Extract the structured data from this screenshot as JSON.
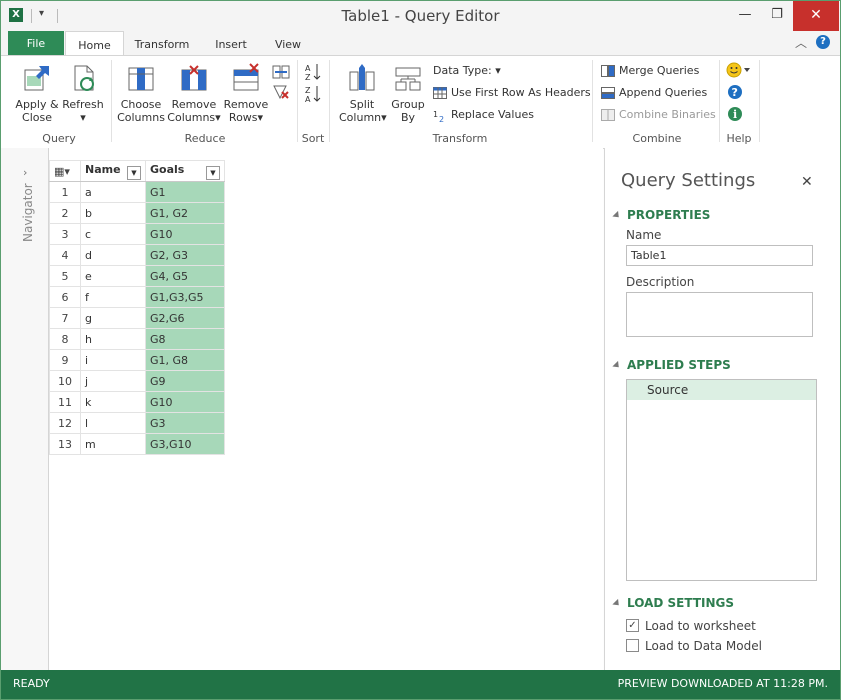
{
  "window": {
    "title": "Table1 - Query Editor",
    "app_icon": "X"
  },
  "tabs": [
    {
      "label": "File"
    },
    {
      "label": "Home"
    },
    {
      "label": "Transform"
    },
    {
      "label": "Insert"
    },
    {
      "label": "View"
    }
  ],
  "ribbon": {
    "query": {
      "group": "Query",
      "apply_close_1": "Apply &",
      "apply_close_2": "Close",
      "refresh": "Refresh"
    },
    "reduce": {
      "group": "Reduce",
      "choose_1": "Choose",
      "choose_2": "Columns",
      "remove_cols_1": "Remove",
      "remove_cols_2": "Columns",
      "remove_rows_1": "Remove",
      "remove_rows_2": "Rows"
    },
    "sort": {
      "group": "Sort"
    },
    "transform": {
      "group": "Transform",
      "split_1": "Split",
      "split_2": "Column",
      "group_by_1": "Group",
      "group_by_2": "By",
      "data_type": "Data Type:",
      "first_row": "Use First Row As Headers",
      "replace": "Replace Values"
    },
    "combine": {
      "group": "Combine",
      "merge": "Merge Queries",
      "append": "Append Queries",
      "binaries": "Combine Binaries"
    },
    "help": {
      "group": "Help"
    }
  },
  "navigator": {
    "label": "Navigator"
  },
  "table": {
    "columns": [
      "Name",
      "Goals"
    ],
    "rows": [
      {
        "idx": "1",
        "name": "a",
        "goals": "G1"
      },
      {
        "idx": "2",
        "name": "b",
        "goals": "G1, G2"
      },
      {
        "idx": "3",
        "name": "c",
        "goals": "G10"
      },
      {
        "idx": "4",
        "name": "d",
        "goals": "G2, G3"
      },
      {
        "idx": "5",
        "name": "e",
        "goals": "G4, G5"
      },
      {
        "idx": "6",
        "name": "f",
        "goals": "G1,G3,G5"
      },
      {
        "idx": "7",
        "name": "g",
        "goals": "G2,G6"
      },
      {
        "idx": "8",
        "name": "h",
        "goals": "G8"
      },
      {
        "idx": "9",
        "name": "i",
        "goals": "G1, G8"
      },
      {
        "idx": "10",
        "name": "j",
        "goals": "G9"
      },
      {
        "idx": "11",
        "name": "k",
        "goals": "G10"
      },
      {
        "idx": "12",
        "name": "l",
        "goals": "G3"
      },
      {
        "idx": "13",
        "name": "m",
        "goals": "G3,G10"
      }
    ]
  },
  "query_settings": {
    "title": "Query Settings",
    "properties_header": "PROPERTIES",
    "name_label": "Name",
    "name_value": "Table1",
    "description_label": "Description",
    "description_value": "",
    "applied_steps_header": "APPLIED STEPS",
    "steps": [
      "Source"
    ],
    "load_settings_header": "LOAD SETTINGS",
    "load_worksheet": "Load to worksheet",
    "load_worksheet_checked": true,
    "load_model": "Load to Data Model",
    "load_model_checked": false
  },
  "status": {
    "left": "READY",
    "right": "PREVIEW DOWNLOADED AT 11:28 PM."
  },
  "colors": {
    "accent": "#217346",
    "selection": "#a7d8b9",
    "close": "#c7302c"
  }
}
